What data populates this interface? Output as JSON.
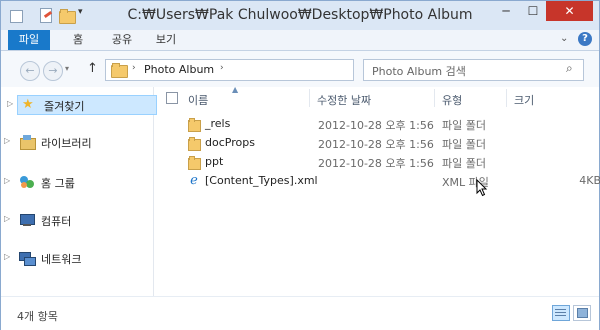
{
  "window": {
    "title": "C:₩Users₩Pak Chulwoo₩Desktop₩Photo Album",
    "min_glyph": "─",
    "max_glyph": "☐",
    "close_glyph": "✕"
  },
  "ribbon": {
    "tabs": [
      "파일",
      "홈",
      "공유",
      "보기"
    ],
    "chevron_glyph": "⌄",
    "help_glyph": "?"
  },
  "address": {
    "back_glyph": "←",
    "forward_glyph": "→",
    "up_glyph": "↑",
    "breadcrumb": "Photo Album",
    "refresh_glyph": "↻"
  },
  "search": {
    "placeholder": "Photo Album 검색",
    "icon_glyph": "⌕"
  },
  "nav_pane": {
    "items": [
      {
        "label": "즐겨찾기",
        "icon": "star-icon"
      },
      {
        "label": "라이브러리",
        "icon": "library-icon"
      },
      {
        "label": "홈 그룹",
        "icon": "homegroup-icon"
      },
      {
        "label": "컴퓨터",
        "icon": "computer-icon"
      },
      {
        "label": "네트워크",
        "icon": "network-icon"
      }
    ]
  },
  "columns": {
    "name": "이름",
    "date": "수정한 날짜",
    "type": "유형",
    "size": "크기"
  },
  "files": [
    {
      "name": "_rels",
      "date": "2012-10-28 오후 1:56",
      "type": "파일 폴더",
      "size": "",
      "icon": "folder-icon"
    },
    {
      "name": "docProps",
      "date": "2012-10-28 오후 1:56",
      "type": "파일 폴더",
      "size": "",
      "icon": "folder-icon"
    },
    {
      "name": "ppt",
      "date": "2012-10-28 오후 1:56",
      "type": "파일 폴더",
      "size": "",
      "icon": "folder-icon"
    },
    {
      "name": "[Content_Types].xml",
      "date": "",
      "type": "XML 파일",
      "size": "4KB",
      "icon": "xml-file-icon"
    }
  ],
  "status": {
    "item_count": "4개 항목"
  },
  "colors": {
    "accent": "#1979ca",
    "close": "#c7352a",
    "selection": "#cde8ff",
    "folder": "#f5c96b"
  }
}
